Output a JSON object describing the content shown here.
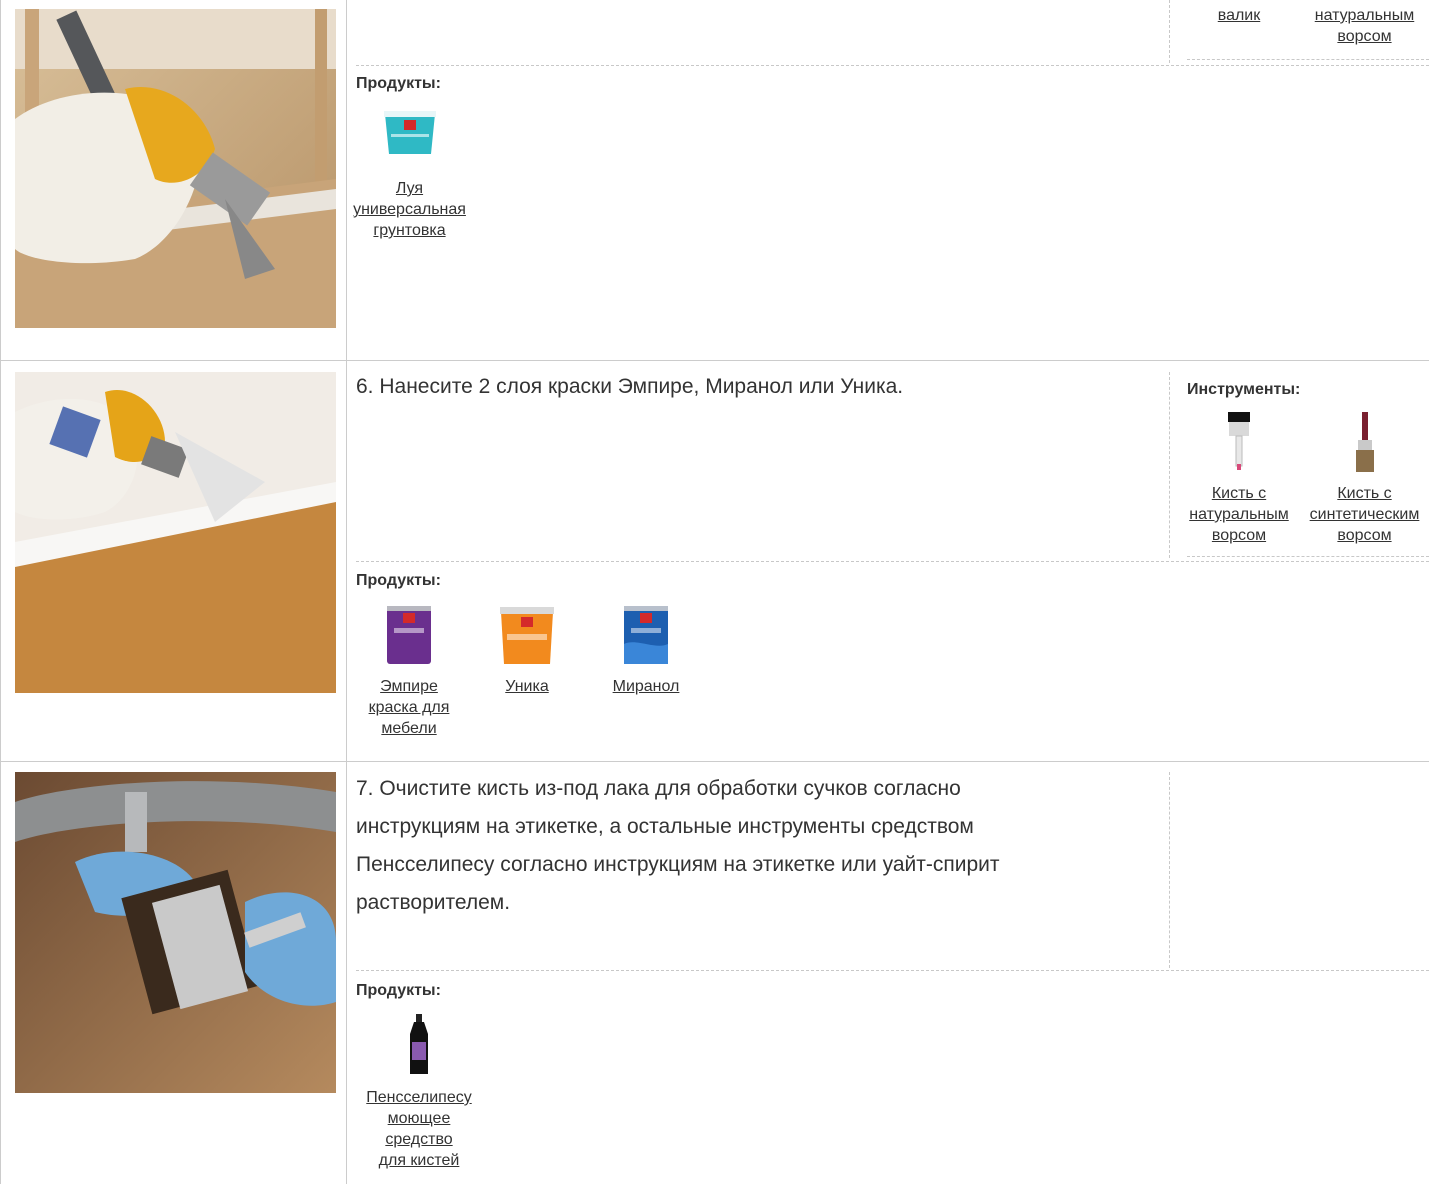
{
  "rows": [
    {
      "products_label": "Продукты:",
      "products": [
        {
          "label_lines": [
            "Луя",
            "универсальная",
            "грунтовка"
          ],
          "icon": "primer-can-icon"
        }
      ],
      "tools_partial": [
        {
          "label_lines": [
            "валик"
          ]
        },
        {
          "label_lines": [
            "натуральным",
            "ворсом"
          ]
        }
      ]
    },
    {
      "step_text": "6. Нанесите 2 слоя краски Эмпире, Миранол или Уника.",
      "tools_label": "Инструменты:",
      "tools": [
        {
          "label_lines": [
            "Кисть с",
            "натуральным",
            "ворсом"
          ],
          "icon": "natural-brush-icon"
        },
        {
          "label_lines": [
            "Кисть с",
            "синтетическим",
            "ворсом"
          ],
          "icon": "synthetic-brush-icon"
        }
      ],
      "products_label": "Продукты:",
      "products": [
        {
          "label_lines": [
            "Эмпире",
            "краска для",
            "мебели"
          ],
          "icon": "empire-can-icon"
        },
        {
          "label_lines": [
            "Уника"
          ],
          "icon": "unika-can-icon"
        },
        {
          "label_lines": [
            "Миранол"
          ],
          "icon": "miranol-can-icon"
        }
      ]
    },
    {
      "step_lines": [
        "7. Очистите кисть из-под лака для обработки сучков согласно",
        "инструкциям на этикетке, а остальные инструменты средством",
        "Пенсселипесу согласно инструкциям на этикетке или уайт-спирит",
        "растворителем."
      ],
      "products_label": "Продукты:",
      "products": [
        {
          "label_lines": [
            "Пенсселипесу",
            "моющее",
            "средство",
            "для кистей"
          ],
          "icon": "cleaner-bottle-icon"
        }
      ]
    }
  ],
  "colors": {
    "border": "#cccccc",
    "dashed": "#c8c8c8",
    "text": "#333333"
  }
}
